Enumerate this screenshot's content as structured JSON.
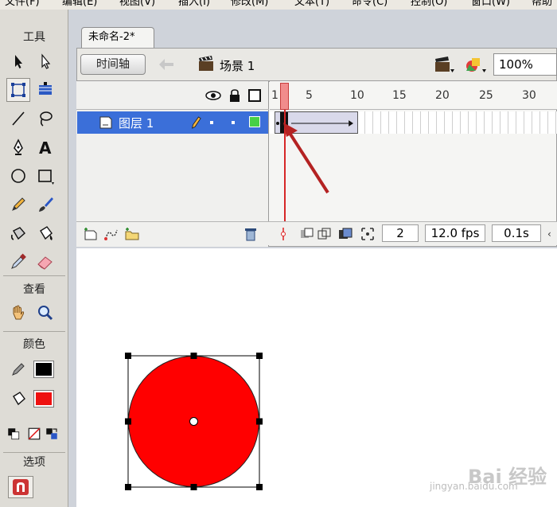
{
  "menu": [
    "文件(F)",
    "编辑(E)",
    "视图(V)",
    "插入(I)",
    "修改(M)",
    "文本(T)",
    "命令(C)",
    "控制(O)",
    "窗口(W)",
    "帮助"
  ],
  "toolbox": {
    "sections": {
      "tools": "工具",
      "view": "查看",
      "colors": "颜色",
      "options": "选项"
    },
    "stroke_color": "#000000",
    "fill_color": "#ee1111"
  },
  "document": {
    "tab_title": "未命名-2*",
    "timeline_button": "时间轴",
    "scene_label": "场景 1",
    "zoom": "100%"
  },
  "timeline": {
    "frame_numbers": [
      "1",
      "5",
      "10",
      "15",
      "20",
      "25",
      "30"
    ],
    "layers": [
      {
        "name": "图层 1",
        "selected": true
      }
    ],
    "current_frame": "2",
    "fps": "12.0 fps",
    "elapsed": "0.1s"
  },
  "stage": {
    "shape_fill": "#ff0000",
    "shape": "circle"
  },
  "watermark": {
    "text": "Bai 经验",
    "url": "jingyan.baidu.com"
  }
}
